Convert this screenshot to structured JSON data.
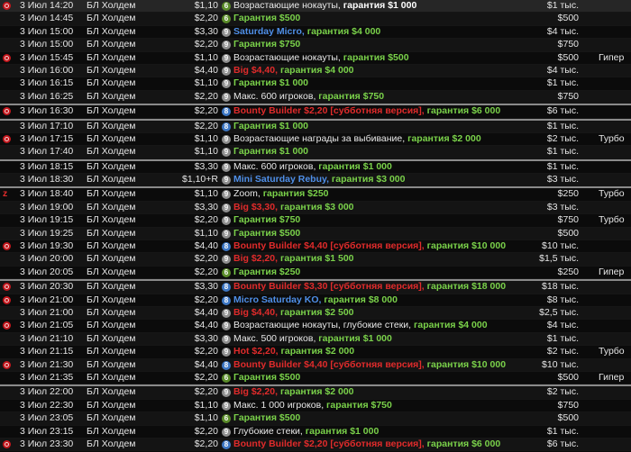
{
  "rows": [
    {
      "date": "3 Июл  14:20",
      "type": "БЛ Холдем",
      "buyin": "$1,10",
      "badge": "6",
      "name": "Возрастающие нокауты,",
      "guarantee": "гарантия $1 000",
      "name_color": "white",
      "guarantee_strong": true,
      "prize": "$1 тыс.",
      "speed": "",
      "icon": "target"
    },
    {
      "date": "3 Июл  14:45",
      "type": "БЛ Холдем",
      "buyin": "$2,20",
      "badge": "6",
      "name": "Гарантия $500",
      "guarantee": "",
      "name_color": "green",
      "prize": "$500",
      "speed": "",
      "icon": ""
    },
    {
      "date": "3 Июл  15:00",
      "type": "БЛ Холдем",
      "buyin": "$3,30",
      "badge": "9",
      "name": "Saturday Micro,",
      "guarantee": "гарантия $4 000",
      "name_color": "blue",
      "prize": "$4 тыс.",
      "speed": "",
      "icon": ""
    },
    {
      "date": "3 Июл  15:00",
      "type": "БЛ Холдем",
      "buyin": "$2,20",
      "badge": "9",
      "name": "Гарантия $750",
      "guarantee": "",
      "name_color": "green",
      "prize": "$750",
      "speed": "",
      "icon": ""
    },
    {
      "date": "3 Июл  15:45",
      "type": "БЛ Холдем",
      "buyin": "$1,10",
      "badge": "9",
      "name": "Возрастающие нокауты,",
      "guarantee": "гарантия $500",
      "name_color": "white",
      "prize": "$500",
      "speed": "Гипер",
      "icon": "target"
    },
    {
      "date": "3 Июл  16:00",
      "type": "БЛ Холдем",
      "buyin": "$4,40",
      "badge": "9",
      "name": "Big $4,40,",
      "guarantee": "гарантия $4 000",
      "name_color": "red",
      "prize": "$4 тыс.",
      "speed": "",
      "icon": ""
    },
    {
      "date": "3 Июл  16:15",
      "type": "БЛ Холдем",
      "buyin": "$1,10",
      "badge": "9",
      "name": "Гарантия $1 000",
      "guarantee": "",
      "name_color": "green",
      "prize": "$1 тыс.",
      "speed": "",
      "icon": ""
    },
    {
      "date": "3 Июл  16:25",
      "type": "БЛ Холдем",
      "buyin": "$2,20",
      "badge": "9",
      "name": "Макс. 600 игроков,",
      "guarantee": "гарантия $750",
      "name_color": "white",
      "prize": "$750",
      "speed": "",
      "icon": ""
    },
    {
      "date": "3 Июл  16:30",
      "type": "БЛ Холдем",
      "buyin": "$2,20",
      "badge": "8",
      "name": "Bounty Builder $2,20 [субботняя версия],",
      "guarantee": "гарантия $6 000",
      "name_color": "red",
      "prize": "$6 тыс.",
      "speed": "",
      "icon": "target",
      "sep": true
    },
    {
      "date": "3 Июл  17:10",
      "type": "БЛ Холдем",
      "buyin": "$2,20",
      "badge": "8",
      "name": "Гарантия $1 000",
      "guarantee": "",
      "name_color": "green",
      "prize": "$1 тыс.",
      "speed": "",
      "icon": "",
      "sep": true
    },
    {
      "date": "3 Июл  17:15",
      "type": "БЛ Холдем",
      "buyin": "$1,10",
      "badge": "9",
      "name": "Возрастающие награды за выбивание,",
      "guarantee": "гарантия $2 000",
      "name_color": "white",
      "prize": "$2 тыс.",
      "speed": "Турбо",
      "icon": "target"
    },
    {
      "date": "3 Июл  17:40",
      "type": "БЛ Холдем",
      "buyin": "$1,10",
      "badge": "9",
      "name": "Гарантия $1 000",
      "guarantee": "",
      "name_color": "green",
      "prize": "$1 тыс.",
      "speed": "",
      "icon": ""
    },
    {
      "date": "3 Июл  18:15",
      "type": "БЛ Холдем",
      "buyin": "$3,30",
      "badge": "9",
      "name": "Макс. 600 игроков,",
      "guarantee": "гарантия $1 000",
      "name_color": "white",
      "prize": "$1 тыс.",
      "speed": "",
      "icon": "",
      "sep": true
    },
    {
      "date": "3 Июл  18:30",
      "type": "БЛ Холдем",
      "buyin": "$1,10+R",
      "badge": "9",
      "name": "Mini Saturday Rebuy,",
      "guarantee": "гарантия $3 000",
      "name_color": "blue",
      "prize": "$3 тыс.",
      "speed": "",
      "icon": ""
    },
    {
      "date": "3 Июл  18:40",
      "type": "БЛ Холдем",
      "buyin": "$1,10",
      "badge": "9",
      "name": "Zoom,",
      "guarantee": "гарантия $250",
      "name_color": "white",
      "prize": "$250",
      "speed": "Турбо",
      "icon": "z",
      "sep": true
    },
    {
      "date": "3 Июл  19:00",
      "type": "БЛ Холдем",
      "buyin": "$3,30",
      "badge": "9",
      "name": "Big $3,30,",
      "guarantee": "гарантия $3 000",
      "name_color": "red",
      "prize": "$3 тыс.",
      "speed": "",
      "icon": ""
    },
    {
      "date": "3 Июл  19:15",
      "type": "БЛ Холдем",
      "buyin": "$2,20",
      "badge": "9",
      "name": "Гарантия $750",
      "guarantee": "",
      "name_color": "green",
      "prize": "$750",
      "speed": "Турбо",
      "icon": ""
    },
    {
      "date": "3 Июл  19:25",
      "type": "БЛ Холдем",
      "buyin": "$1,10",
      "badge": "9",
      "name": "Гарантия $500",
      "guarantee": "",
      "name_color": "green",
      "prize": "$500",
      "speed": "",
      "icon": ""
    },
    {
      "date": "3 Июл  19:30",
      "type": "БЛ Холдем",
      "buyin": "$4,40",
      "badge": "8",
      "name": "Bounty Builder $4,40 [субботняя версия],",
      "guarantee": "гарантия $10 000",
      "name_color": "red",
      "prize": "$10 тыс.",
      "speed": "",
      "icon": "target"
    },
    {
      "date": "3 Июл  20:00",
      "type": "БЛ Холдем",
      "buyin": "$2,20",
      "badge": "9",
      "name": "Big $2,20,",
      "guarantee": "гарантия $1 500",
      "name_color": "red",
      "prize": "$1,5 тыс.",
      "speed": "",
      "icon": ""
    },
    {
      "date": "3 Июл  20:05",
      "type": "БЛ Холдем",
      "buyin": "$2,20",
      "badge": "6",
      "name": "Гарантия $250",
      "guarantee": "",
      "name_color": "green",
      "prize": "$250",
      "speed": "Гипер",
      "icon": ""
    },
    {
      "date": "3 Июл  20:30",
      "type": "БЛ Холдем",
      "buyin": "$3,30",
      "badge": "8",
      "name": "Bounty Builder $3,30 [субботняя версия],",
      "guarantee": "гарантия $18 000",
      "name_color": "red",
      "prize": "$18 тыс.",
      "speed": "",
      "icon": "target",
      "sep": true
    },
    {
      "date": "3 Июл  21:00",
      "type": "БЛ Холдем",
      "buyin": "$2,20",
      "badge": "8",
      "name": "Micro Saturday KO,",
      "guarantee": "гарантия $8 000",
      "name_color": "blue",
      "prize": "$8 тыс.",
      "speed": "",
      "icon": "target"
    },
    {
      "date": "3 Июл  21:00",
      "type": "БЛ Холдем",
      "buyin": "$4,40",
      "badge": "9",
      "name": "Big $4,40,",
      "guarantee": "гарантия $2 500",
      "name_color": "red",
      "prize": "$2,5 тыс.",
      "speed": "",
      "icon": ""
    },
    {
      "date": "3 Июл  21:05",
      "type": "БЛ Холдем",
      "buyin": "$4,40",
      "badge": "9",
      "name": "Возрастающие нокауты, глубокие стеки,",
      "guarantee": "гарантия $4 000",
      "name_color": "white",
      "prize": "$4 тыс.",
      "speed": "",
      "icon": "target"
    },
    {
      "date": "3 Июл  21:10",
      "type": "БЛ Холдем",
      "buyin": "$3,30",
      "badge": "9",
      "name": "Макс. 500 игроков,",
      "guarantee": "гарантия $1 000",
      "name_color": "white",
      "prize": "$1 тыс.",
      "speed": "",
      "icon": ""
    },
    {
      "date": "3 Июл  21:15",
      "type": "БЛ Холдем",
      "buyin": "$2,20",
      "badge": "9",
      "name": "Hot $2,20,",
      "guarantee": "гарантия $2 000",
      "name_color": "red",
      "prize": "$2 тыс.",
      "speed": "Турбо",
      "icon": ""
    },
    {
      "date": "3 Июл  21:30",
      "type": "БЛ Холдем",
      "buyin": "$4,40",
      "badge": "8",
      "name": "Bounty Builder $4,40 [субботняя версия],",
      "guarantee": "гарантия $10 000",
      "name_color": "red",
      "prize": "$10 тыс.",
      "speed": "",
      "icon": "target"
    },
    {
      "date": "3 Июл  21:35",
      "type": "БЛ Холдем",
      "buyin": "$2,20",
      "badge": "6",
      "name": "Гарантия $500",
      "guarantee": "",
      "name_color": "green",
      "prize": "$500",
      "speed": "Гипер",
      "icon": ""
    },
    {
      "date": "3 Июл  22:00",
      "type": "БЛ Холдем",
      "buyin": "$2,20",
      "badge": "9",
      "name": "Big $2,20,",
      "guarantee": "гарантия $2 000",
      "name_color": "red",
      "prize": "$2 тыс.",
      "speed": "",
      "icon": "",
      "sep": true
    },
    {
      "date": "3 Июл  22:30",
      "type": "БЛ Холдем",
      "buyin": "$1,10",
      "badge": "9",
      "name": "Макс. 1 000 игроков,",
      "guarantee": "гарантия $750",
      "name_color": "white",
      "prize": "$750",
      "speed": "",
      "icon": ""
    },
    {
      "date": "3 Июл  23:05",
      "type": "БЛ Холдем",
      "buyin": "$1,10",
      "badge": "6",
      "name": "Гарантия $500",
      "guarantee": "",
      "name_color": "green",
      "prize": "$500",
      "speed": "",
      "icon": ""
    },
    {
      "date": "3 Июл  23:15",
      "type": "БЛ Холдем",
      "buyin": "$2,20",
      "badge": "9",
      "name": "Глубокие стеки,",
      "guarantee": "гарантия $1 000",
      "name_color": "white",
      "prize": "$1 тыс.",
      "speed": "",
      "icon": ""
    },
    {
      "date": "3 Июл  23:30",
      "type": "БЛ Холдем",
      "buyin": "$2,20",
      "badge": "8",
      "name": "Bounty Builder $2,20 [субботняя версия],",
      "guarantee": "гарантия $6 000",
      "name_color": "red",
      "prize": "$6 тыс.",
      "speed": "",
      "icon": "target"
    }
  ]
}
